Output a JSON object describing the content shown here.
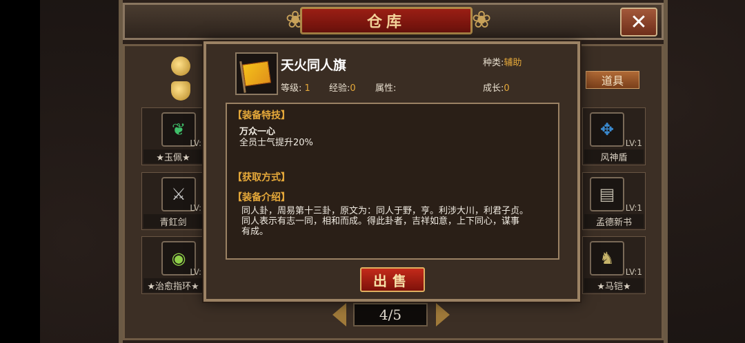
{
  "window": {
    "title": "仓库",
    "close_label": "✕"
  },
  "tabs": {
    "items_label": "道具"
  },
  "currency": {
    "coin_icon": "coin-icon",
    "ingot_icon": "gold-ingot-icon"
  },
  "left_slots": [
    {
      "name": "★玉佩★",
      "level": "LV:",
      "icon": "jade-pendant-icon"
    },
    {
      "name": "青釭剑",
      "level": "LV:",
      "icon": "sword-icon"
    },
    {
      "name": "★治愈指环★",
      "level": "LV:",
      "icon": "ring-icon"
    }
  ],
  "right_slots": [
    {
      "name": "风神盾",
      "level": "LV:1",
      "icon": "shield-icon"
    },
    {
      "name": "孟德新书",
      "level": "LV:1",
      "icon": "book-icon"
    },
    {
      "name": "★马铠★",
      "level": "LV:1",
      "icon": "horse-armor-icon"
    }
  ],
  "pager": {
    "text": "4/5"
  },
  "popup": {
    "item_name": "天火同人旗",
    "item_icon": "flag-icon",
    "type_label": "种类:",
    "type_value": "辅助",
    "level_label": "等级:",
    "level_value": "1",
    "exp_label": "经验:",
    "exp_value": "0",
    "attr_label": "属性:",
    "growth_label": "成长:",
    "growth_value": "0",
    "skill_header": "【装备特技】",
    "skill_name": "万众一心",
    "skill_desc": "全员士气提升20%",
    "obtain_header": "【获取方式】",
    "intro_header": "【装备介绍】",
    "intro_lines": [
      "同人卦，周易第十三卦，原文为：同人于野，亨。利涉大川，利君子贞。",
      "同人表示有志一同，相和而成。得此卦者，吉祥如意，上下同心，谋事",
      "有成。"
    ],
    "sell_label": "出售"
  },
  "colors": {
    "accent": "#e6a93a",
    "sell_red": "#c32a1a",
    "frame": "#9b8264"
  }
}
